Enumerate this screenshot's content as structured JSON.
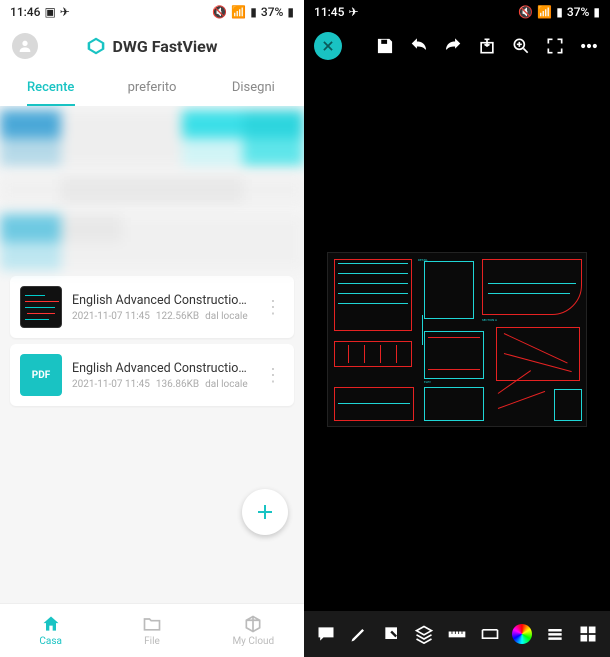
{
  "left": {
    "status": {
      "time": "11:46",
      "battery": "37%"
    },
    "app_title": "DWG FastView",
    "tabs": {
      "recent": "Recente",
      "favorite": "preferito",
      "drawings": "Disegni"
    },
    "files": [
      {
        "name": "English Advanced Construction.dwg",
        "date": "2021-11-07 11:45",
        "size": "122.56KB",
        "source": "dal locale",
        "type": "dwg"
      },
      {
        "name": "English Advanced Construction.pdf",
        "date": "2021-11-07 11:45",
        "size": "136.86KB",
        "source": "dal locale",
        "type": "pdf",
        "badge": "PDF"
      }
    ],
    "nav": {
      "home": "Casa",
      "file": "File",
      "cloud": "My Cloud"
    }
  },
  "right": {
    "status": {
      "time": "11:45",
      "battery": "37%"
    }
  }
}
